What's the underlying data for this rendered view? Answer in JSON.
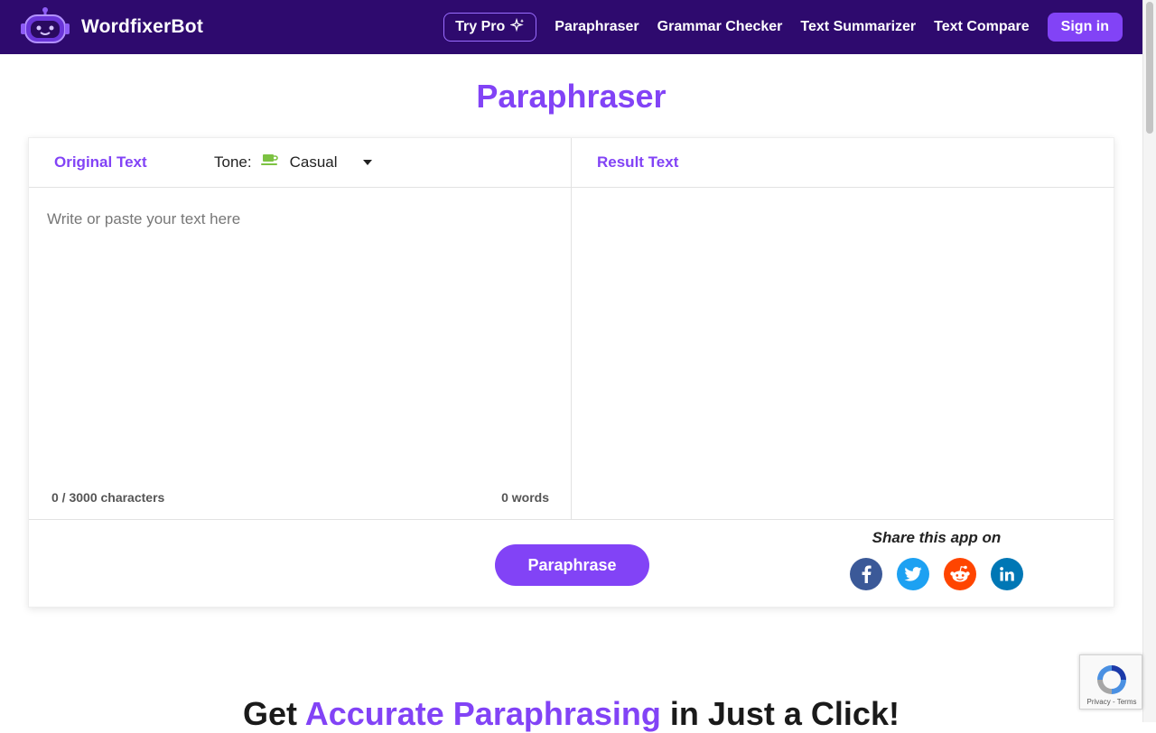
{
  "header": {
    "brand_name": "WordfixerBot",
    "try_pro_label": "Try Pro",
    "nav_items": [
      "Paraphraser",
      "Grammar Checker",
      "Text Summarizer",
      "Text Compare"
    ],
    "sign_in_label": "Sign in"
  },
  "page": {
    "title": "Paraphraser"
  },
  "editor": {
    "original_label": "Original Text",
    "tone_label": "Tone:",
    "tone_value": "Casual",
    "input_placeholder": "Write or paste your text here",
    "input_value": "",
    "char_count": "0 / 3000 characters",
    "word_count": "0 words",
    "result_label": "Result Text",
    "result_value": ""
  },
  "actions": {
    "paraphrase_label": "Paraphrase",
    "share_title": "Share this app on",
    "share_networks": [
      "facebook-icon",
      "twitter-icon",
      "reddit-icon",
      "linkedin-icon"
    ]
  },
  "bottom": {
    "heading_pre": "Get ",
    "heading_accent": "Accurate Paraphrasing",
    "heading_post": " in Just a Click!"
  },
  "recaptcha": {
    "text": "Privacy - Terms"
  },
  "colors": {
    "header_bg": "#2e0a6e",
    "accent": "#8243f6"
  }
}
